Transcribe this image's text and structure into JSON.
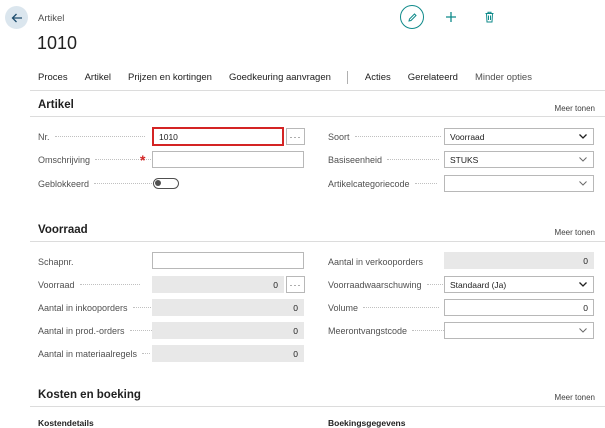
{
  "header": {
    "entity_type": "Artikel",
    "record_title": "1010"
  },
  "menu": {
    "items": [
      "Proces",
      "Artikel",
      "Prijzen en kortingen",
      "Goedkeuring aanvragen"
    ],
    "items_right": [
      "Acties",
      "Gerelateerd"
    ],
    "less_options": "Minder opties"
  },
  "artikel": {
    "title": "Artikel",
    "more": "Meer tonen",
    "nr_label": "Nr.",
    "nr_value": "1010",
    "omschrijving_label": "Omschrijving",
    "omschrijving_value": "",
    "geblokkeerd_label": "Geblokkeerd",
    "soort_label": "Soort",
    "soort_value": "Voorraad",
    "basiseenheid_label": "Basiseenheid",
    "basiseenheid_value": "STUKS",
    "artikelcategoriecode_label": "Artikelcategoriecode",
    "artikelcategoriecode_value": ""
  },
  "voorraad": {
    "title": "Voorraad",
    "more": "Meer tonen",
    "schapnr_label": "Schapnr.",
    "schapnr_value": "",
    "voorraad_label": "Voorraad",
    "voorraad_value": "0",
    "inkooporders_label": "Aantal in inkooporders",
    "inkooporders_value": "0",
    "prodorders_label": "Aantal in prod.-orders",
    "prodorders_value": "0",
    "materiaalregels_label": "Aantal in materiaalregels",
    "materiaalregels_value": "0",
    "verkooporders_label": "Aantal in verkooporders",
    "verkooporders_value": "0",
    "waarschuwing_label": "Voorraadwaarschuwing",
    "waarschuwing_value": "Standaard (Ja)",
    "volume_label": "Volume",
    "volume_value": "0",
    "meerontvangst_label": "Meerontvangstcode",
    "meerontvangst_value": ""
  },
  "kosten": {
    "title": "Kosten en boeking",
    "more": "Meer tonen",
    "kostendetails": "Kostendetails",
    "boekingsgegevens": "Boekingsgegevens"
  },
  "colors": {
    "accent": "#0f8a8a",
    "required": "#d42424",
    "focus_border": "#d42424"
  },
  "icons": {
    "back": "arrow-left-icon",
    "edit": "pencil-icon",
    "add": "plus-icon",
    "delete": "trash-icon"
  }
}
